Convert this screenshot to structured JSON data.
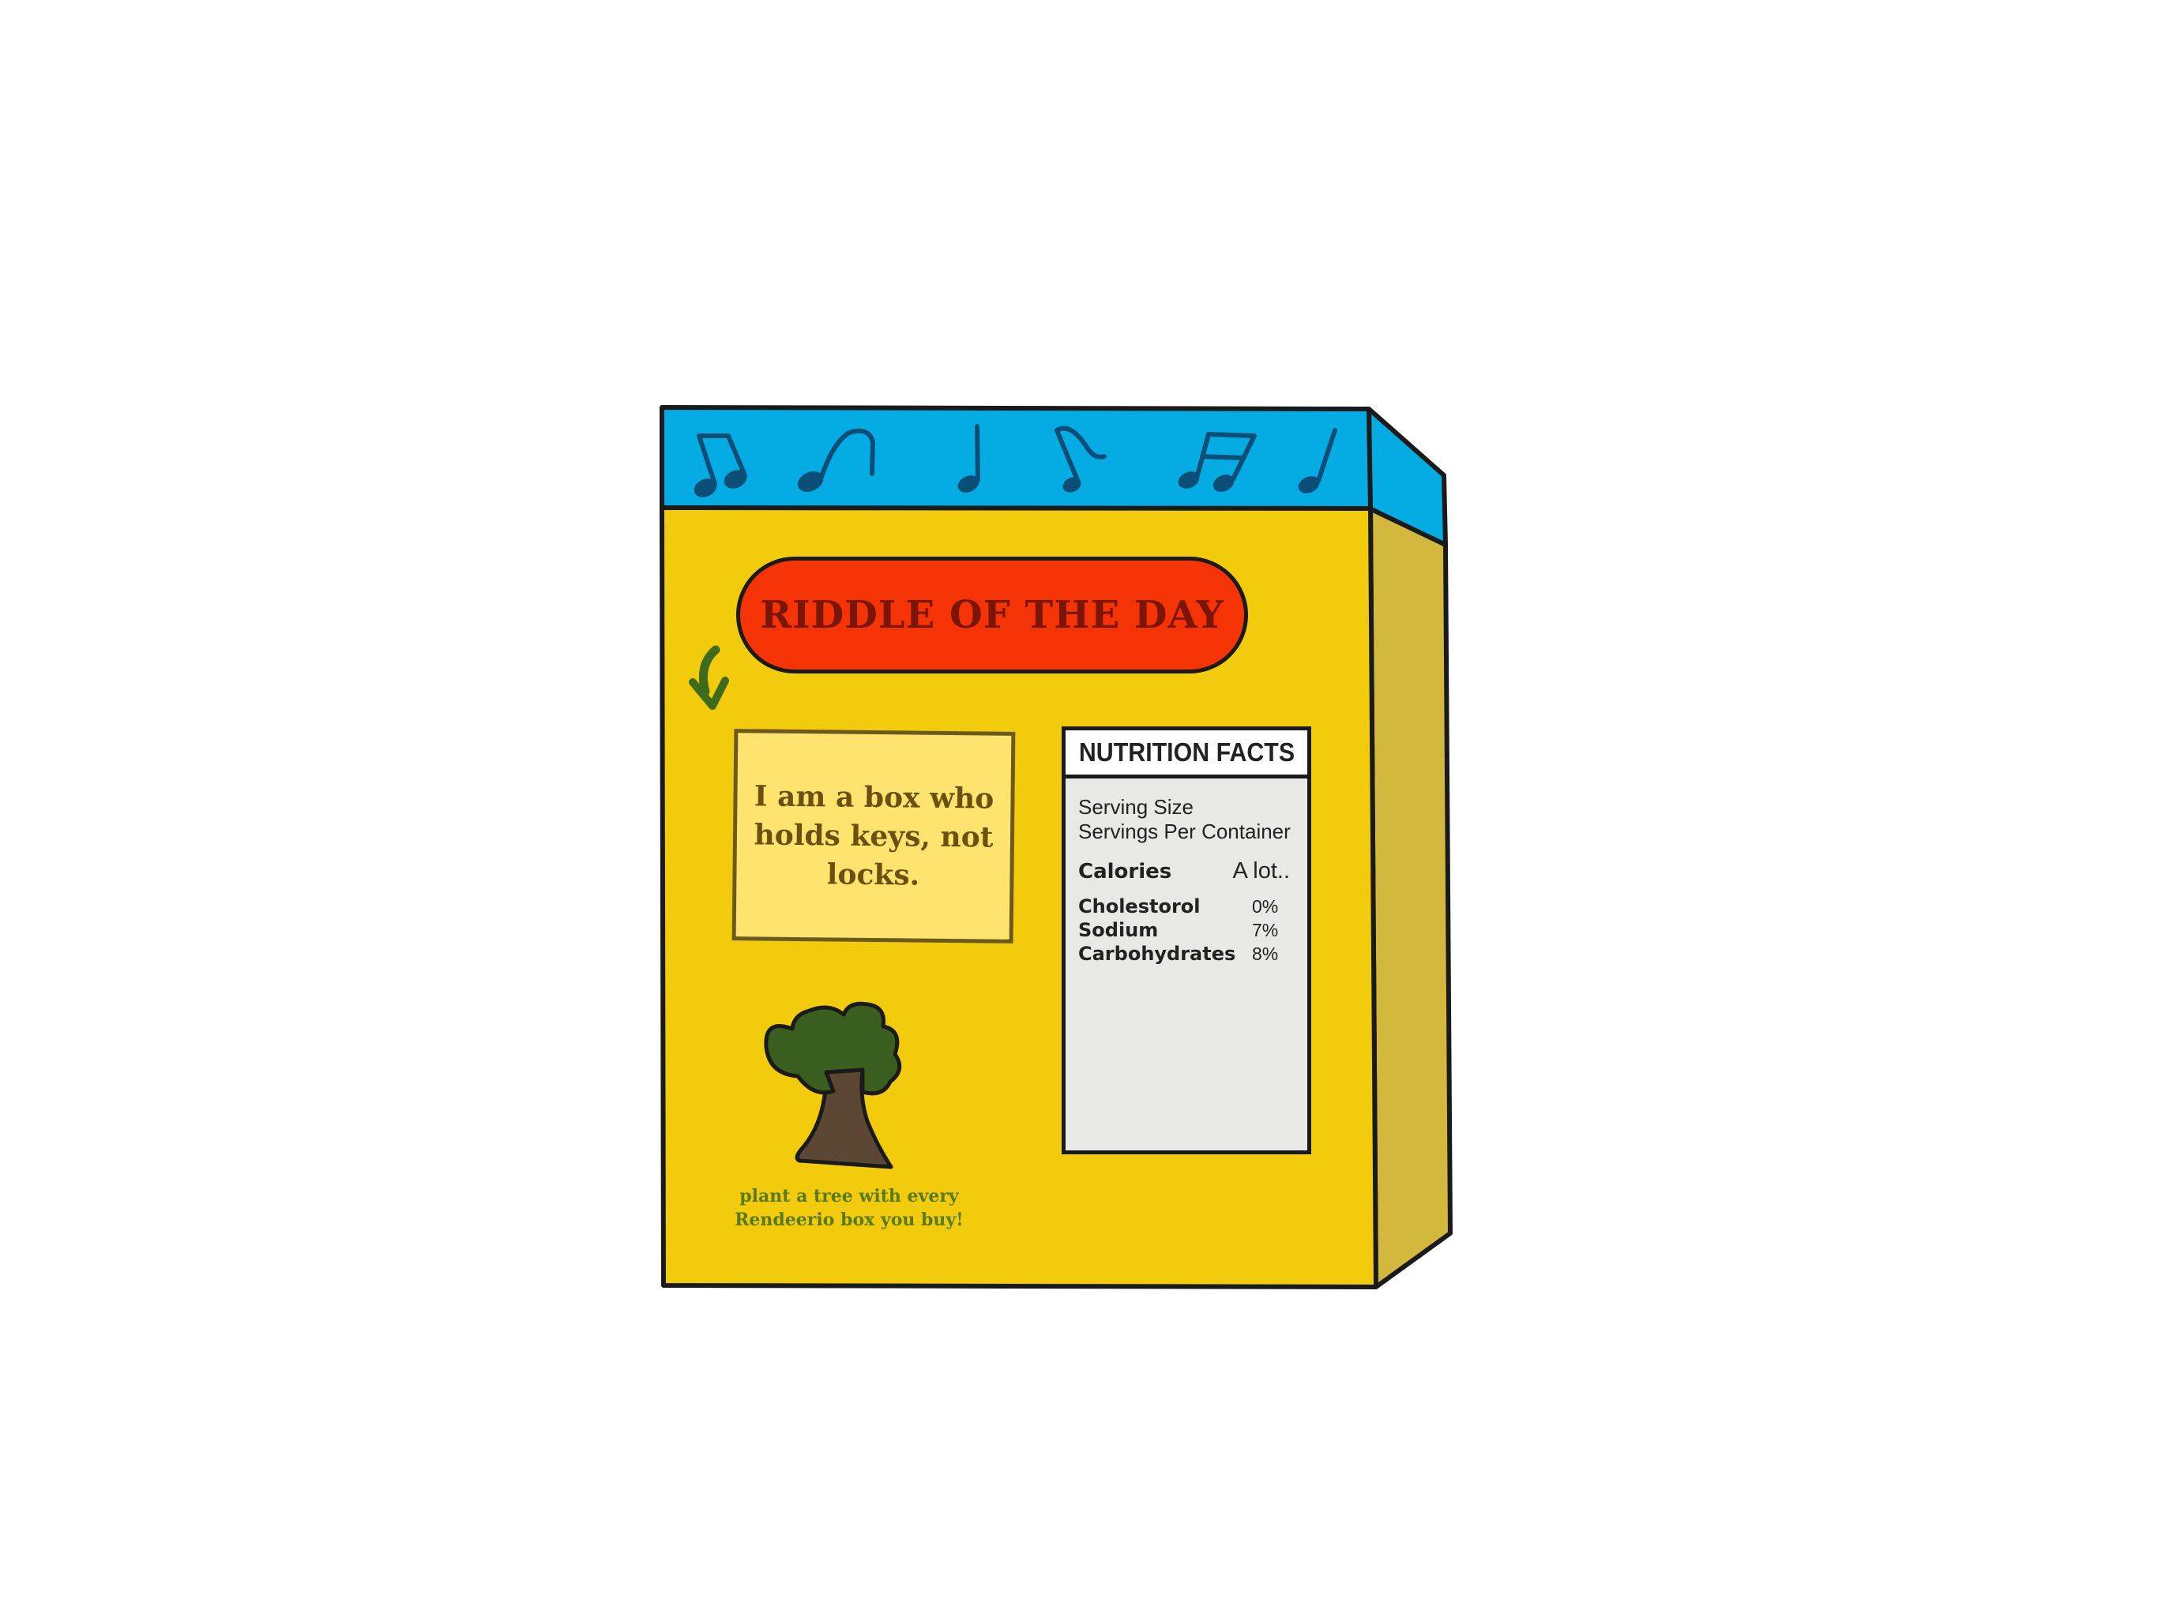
{
  "box": {
    "riddle_title": "RIDDLE OF THE DAY",
    "riddle_text": "I am a box who holds keys, not locks.",
    "nutrition": {
      "title": "NUTRITION FACTS",
      "serving_size": "Serving Size",
      "servings_per_container": "Servings Per Container",
      "calories_label": "Calories",
      "calories_value": "A lot..",
      "nutrients": [
        {
          "name": "Cholestorol",
          "percent": "0%"
        },
        {
          "name": "Sodium",
          "percent": "7%"
        },
        {
          "name": "Carbohydrates",
          "percent": "8%"
        }
      ]
    },
    "tree_caption": {
      "line1": "plant a tree with every",
      "line2": "Rendeerio box you buy!"
    }
  },
  "icons": [
    "music-notes-icon",
    "curved-arrow-icon",
    "tree-icon"
  ],
  "colors": {
    "box_front": "#f2cb0c",
    "box_side": "#d2b83c",
    "box_top_band": "#05abe3",
    "music_notes": "#0b4f78",
    "riddle_pill": "#f53406",
    "riddle_title_text": "#7a1508",
    "riddle_card": "#fee46f",
    "arrow": "#3d6b1a",
    "tree_canopy": "#3a5e1e",
    "tree_trunk": "#5b4733",
    "caption_text": "#5a7a1e",
    "nutrition_panel": "#e8e8e6"
  }
}
